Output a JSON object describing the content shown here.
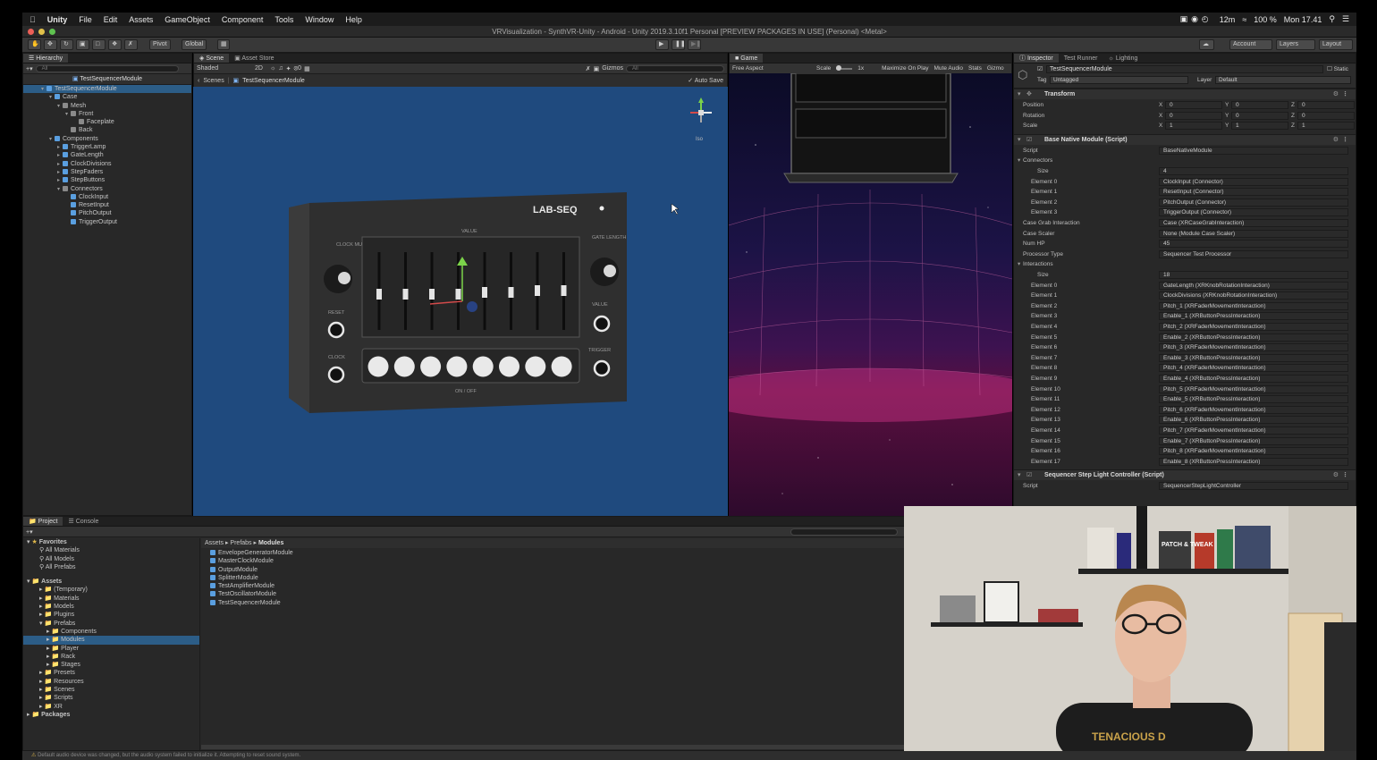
{
  "menubar": {
    "app_name": "Unity",
    "items": [
      "File",
      "Edit",
      "Assets",
      "GameObject",
      "Component",
      "Tools",
      "Window",
      "Help"
    ],
    "time": "12m",
    "battery": "100 %",
    "clock": "Mon 17.41"
  },
  "window_title": "VRVisualization - SynthVR-Unity - Android - Unity 2019.3.10f1 Personal [PREVIEW PACKAGES IN USE] (Personal) <Metal>",
  "toolbar": {
    "pivot": "Pivot",
    "global": "Global",
    "account": "Account",
    "layers": "Layers",
    "layout": "Layout"
  },
  "hierarchy": {
    "tab": "Hierarchy",
    "search_placeholder": "All",
    "scene": "TestSequencerModule",
    "items": [
      {
        "label": "TestSequencerModule",
        "depth": 0
      },
      {
        "label": "Case",
        "depth": 1
      },
      {
        "label": "Mesh",
        "depth": 2
      },
      {
        "label": "Front",
        "depth": 3
      },
      {
        "label": "Faceplate",
        "depth": 4
      },
      {
        "label": "Back",
        "depth": 3
      },
      {
        "label": "Components",
        "depth": 1
      },
      {
        "label": "TriggerLamp",
        "depth": 2
      },
      {
        "label": "GateLength",
        "depth": 2
      },
      {
        "label": "ClockDivisions",
        "depth": 2
      },
      {
        "label": "StepFaders",
        "depth": 2
      },
      {
        "label": "StepButtons",
        "depth": 2
      },
      {
        "label": "Connectors",
        "depth": 2
      },
      {
        "label": "ClockInput",
        "depth": 3
      },
      {
        "label": "ResetInput",
        "depth": 3
      },
      {
        "label": "PitchOutput",
        "depth": 3
      },
      {
        "label": "TriggerOutput",
        "depth": 3
      }
    ]
  },
  "scene": {
    "tabs": [
      "Scene",
      "Asset Store"
    ],
    "shading": "Shaded",
    "mode_2d": "2D",
    "gizmos": "Gizmos",
    "search_placeholder": "All",
    "breadcrumb_root": "Scenes",
    "breadcrumb_current": "TestSequencerModule",
    "auto_save": "Auto Save",
    "gizmo_label": "Iso",
    "module": {
      "title": "LAB-SEQ",
      "clock_multiplier": "CLOCK MULTIPLIER",
      "value_top": "VALUE",
      "gate_length": "GATE LENGTH",
      "reset": "RESET",
      "value_right": "VALUE",
      "clock": "CLOCK",
      "trigger": "TRIGGER",
      "on_off": "ON / OFF"
    }
  },
  "game": {
    "tab": "Game",
    "aspect": "Free Aspect",
    "scale_label": "Scale",
    "scale_value": "1x",
    "maximize": "Maximize On Play",
    "mute": "Mute Audio",
    "stats": "Stats",
    "gizmos": "Gizmo"
  },
  "inspector": {
    "tabs": [
      "Inspector",
      "Test Runner",
      "Lighting"
    ],
    "object_name": "TestSequencerModule",
    "static_label": "Static",
    "tag_label": "Tag",
    "tag_value": "Untagged",
    "layer_label": "Layer",
    "layer_value": "Default",
    "transform": {
      "title": "Transform",
      "rows": [
        {
          "label": "Position",
          "x": "0",
          "y": "0",
          "z": "0"
        },
        {
          "label": "Rotation",
          "x": "0",
          "y": "0",
          "z": "0"
        },
        {
          "label": "Scale",
          "x": "1",
          "y": "1",
          "z": "1"
        }
      ]
    },
    "base_module": {
      "title": "Base Native Module (Script)",
      "script_label": "Script",
      "script_value": "BaseNativeModule",
      "connectors_label": "Connectors",
      "size_label": "Size",
      "connectors_size": "4",
      "connectors": [
        {
          "label": "Element 0",
          "value": "ClockInput (Connector)"
        },
        {
          "label": "Element 1",
          "value": "ResetInput (Connector)"
        },
        {
          "label": "Element 2",
          "value": "PitchOutput (Connector)"
        },
        {
          "label": "Element 3",
          "value": "TriggerOutput (Connector)"
        }
      ],
      "case_grab_label": "Case Grab Interaction",
      "case_grab_value": "Case (XRCaseGrabInteraction)",
      "case_scaler_label": "Case Scaler",
      "case_scaler_value": "None (Module Case Scaler)",
      "num_hp_label": "Num HP",
      "num_hp_value": "45",
      "processor_label": "Processor Type",
      "processor_value": "Sequencer Test Processor",
      "interactions_label": "Interactions",
      "interactions_size": "18",
      "interactions": [
        {
          "label": "Element 0",
          "value": "GateLength (XRKnobRotationInteraction)"
        },
        {
          "label": "Element 1",
          "value": "ClockDivisions (XRKnobRotationInteraction)"
        },
        {
          "label": "Element 2",
          "value": "Pitch_1 (XRFaderMovementInteraction)"
        },
        {
          "label": "Element 3",
          "value": "Enable_1 (XRButtonPressInteraction)"
        },
        {
          "label": "Element 4",
          "value": "Pitch_2 (XRFaderMovementInteraction)"
        },
        {
          "label": "Element 5",
          "value": "Enable_2 (XRButtonPressInteraction)"
        },
        {
          "label": "Element 6",
          "value": "Pitch_3 (XRFaderMovementInteraction)"
        },
        {
          "label": "Element 7",
          "value": "Enable_3 (XRButtonPressInteraction)"
        },
        {
          "label": "Element 8",
          "value": "Pitch_4 (XRFaderMovementInteraction)"
        },
        {
          "label": "Element 9",
          "value": "Enable_4 (XRButtonPressInteraction)"
        },
        {
          "label": "Element 10",
          "value": "Pitch_5 (XRFaderMovementInteraction)"
        },
        {
          "label": "Element 11",
          "value": "Enable_5 (XRButtonPressInteraction)"
        },
        {
          "label": "Element 12",
          "value": "Pitch_6 (XRFaderMovementInteraction)"
        },
        {
          "label": "Element 13",
          "value": "Enable_6 (XRButtonPressInteraction)"
        },
        {
          "label": "Element 14",
          "value": "Pitch_7 (XRFaderMovementInteraction)"
        },
        {
          "label": "Element 15",
          "value": "Enable_7 (XRButtonPressInteraction)"
        },
        {
          "label": "Element 16",
          "value": "Pitch_8 (XRFaderMovementInteraction)"
        },
        {
          "label": "Element 17",
          "value": "Enable_8 (XRButtonPressInteraction)"
        }
      ]
    },
    "step_light": {
      "title": "Sequencer Step Light Controller (Script)",
      "script_label": "Script",
      "script_value": "SequencerStepLightController"
    }
  },
  "project": {
    "tabs": [
      "Project",
      "Console"
    ],
    "favorites_label": "Favorites",
    "favorites": [
      "All Materials",
      "All Models",
      "All Prefabs"
    ],
    "assets_label": "Assets",
    "assets_tree": [
      {
        "label": "(Temporary)",
        "depth": 1
      },
      {
        "label": "Materials",
        "depth": 1
      },
      {
        "label": "Models",
        "depth": 1
      },
      {
        "label": "Plugins",
        "depth": 1
      },
      {
        "label": "Prefabs",
        "depth": 1
      },
      {
        "label": "Components",
        "depth": 2
      },
      {
        "label": "Modules",
        "depth": 2
      },
      {
        "label": "Player",
        "depth": 2
      },
      {
        "label": "Rack",
        "depth": 2
      },
      {
        "label": "Stages",
        "depth": 2
      },
      {
        "label": "Presets",
        "depth": 1
      },
      {
        "label": "Resources",
        "depth": 1
      },
      {
        "label": "Scenes",
        "depth": 1
      },
      {
        "label": "Scripts",
        "depth": 1
      },
      {
        "label": "XR",
        "depth": 1
      }
    ],
    "packages_label": "Packages",
    "breadcrumb": [
      "Assets",
      "Prefabs",
      "Modules"
    ],
    "files": [
      "EnvelopeGeneratorModule",
      "MasterClockModule",
      "OutputModule",
      "SplitterModule",
      "TestAmplifierModule",
      "TestOscillatorModule",
      "TestSequencerModule"
    ]
  },
  "status": {
    "message": "Default audio device was changed, but the audio system failed to initialize it. Attempting to reset sound system."
  },
  "webcam": {
    "book1": "PATCH & TWEAK",
    "shirt": "TENACIOUS D"
  }
}
